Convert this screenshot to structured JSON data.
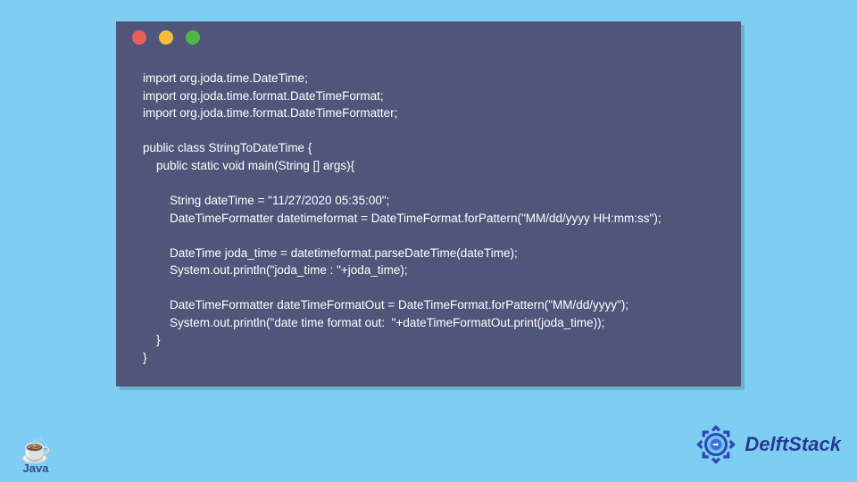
{
  "code": {
    "lines": [
      "import org.joda.time.DateTime;",
      "import org.joda.time.format.DateTimeFormat;",
      "import org.joda.time.format.DateTimeFormatter;",
      "",
      "public class StringToDateTime {",
      "    public static void main(String [] args){",
      "",
      "        String dateTime = \"11/27/2020 05:35:00\";",
      "        DateTimeFormatter datetimeformat = DateTimeFormat.forPattern(\"MM/dd/yyyy HH:mm:ss\");",
      "",
      "        DateTime joda_time = datetimeformat.parseDateTime(dateTime);",
      "        System.out.println(\"joda_time : \"+joda_time);",
      "",
      "        DateTimeFormatter dateTimeFormatOut = DateTimeFormat.forPattern(\"MM/dd/yyyy\");",
      "        System.out.println(\"date time format out:  \"+dateTimeFormatOut.print(joda_time));",
      "    }",
      "}"
    ]
  },
  "logos": {
    "java_label": "Java",
    "delft_label": "DelftStack"
  },
  "window": {
    "dot_red": "#ec5f59",
    "dot_yellow": "#f6bd3b",
    "dot_green": "#4fb748"
  }
}
